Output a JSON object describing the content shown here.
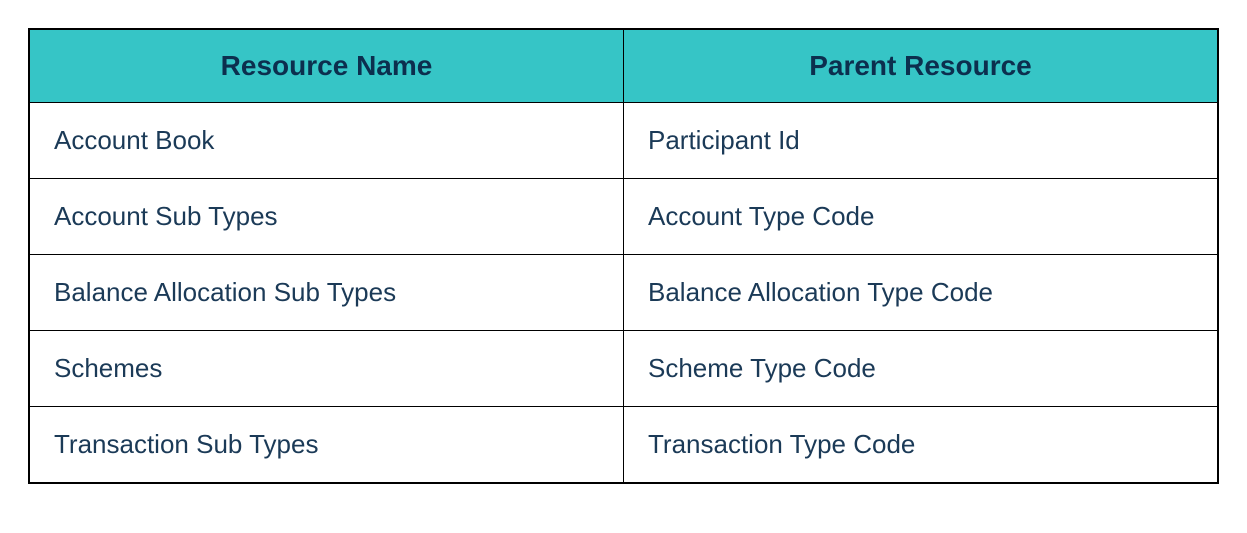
{
  "table": {
    "headers": {
      "col1": "Resource Name",
      "col2": "Parent Resource"
    },
    "rows": [
      {
        "resource_name": "Account Book",
        "parent_resource": "Participant Id"
      },
      {
        "resource_name": "Account Sub Types",
        "parent_resource": "Account Type Code"
      },
      {
        "resource_name": "Balance Allocation Sub Types",
        "parent_resource": "Balance Allocation Type Code"
      },
      {
        "resource_name": "Schemes",
        "parent_resource": "Scheme Type Code"
      },
      {
        "resource_name": "Transaction Sub Types",
        "parent_resource": "Transaction Type Code"
      }
    ]
  },
  "colors": {
    "header_bg": "#36c5c6",
    "text_dark": "#0c2f4e",
    "cell_text": "#1b3a57",
    "border": "#000000"
  }
}
